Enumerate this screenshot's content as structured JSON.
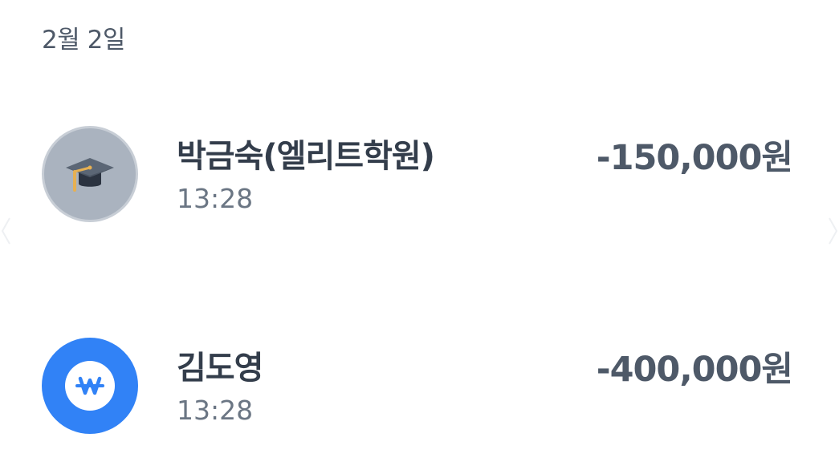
{
  "date_header": "2월 2일",
  "transactions": [
    {
      "name": "박금숙(엘리트학원)",
      "time": "13:28",
      "amount": "-150,000원",
      "icon": "graduation-cap-icon"
    },
    {
      "name": "김도영",
      "time": "13:28",
      "amount": "-400,000원",
      "icon": "won-icon"
    }
  ],
  "colors": {
    "primary_text": "#333d4b",
    "secondary_text": "#6b7684",
    "amount_text": "#4e5968",
    "blue_accent": "#3182f6",
    "gray_avatar": "#aab3bf"
  }
}
